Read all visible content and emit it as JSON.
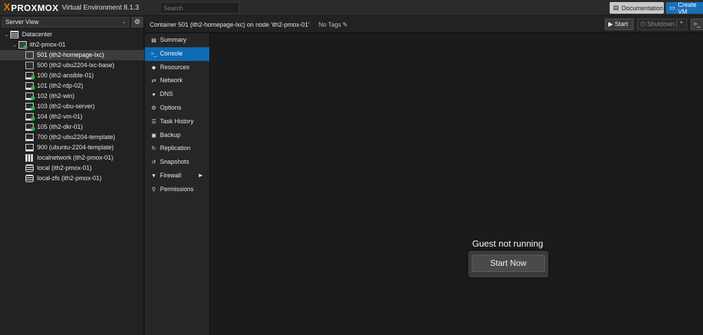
{
  "header": {
    "logo_x": "X",
    "logo_word": "PROXMOX",
    "version_label": "Virtual Environment 8.1.3",
    "search_placeholder": "Search",
    "documentation_label": "Documentation",
    "create_vm_label": "Create VM"
  },
  "sidebar": {
    "view_label": "Server View",
    "tree": [
      {
        "label": "Datacenter",
        "icon": "datacenter-icon"
      },
      {
        "label": "ith2-pmox-01",
        "icon": "node-online-icon"
      },
      {
        "label": "501 (ith2-homepage-lxc)",
        "icon": "container-stopped-icon",
        "selected": true
      },
      {
        "label": "500 (ith2-ubu2204-lxc-base)",
        "icon": "container-template-icon"
      },
      {
        "label": "100 (ith2-ansible-01)",
        "icon": "vm-running-icon"
      },
      {
        "label": "101 (ith2-rdp-02)",
        "icon": "vm-running-icon"
      },
      {
        "label": "102 (ith2-win)",
        "icon": "vm-running-icon"
      },
      {
        "label": "103 (ith2-ubu-server)",
        "icon": "vm-running-icon"
      },
      {
        "label": "104 (ith2-vm-01)",
        "icon": "vm-running-icon"
      },
      {
        "label": "105 (ith2-dkr-01)",
        "icon": "vm-running-icon"
      },
      {
        "label": "700 (ith2-ubu2204-template)",
        "icon": "vm-template-icon"
      },
      {
        "label": "900 (ubuntu-2204-template)",
        "icon": "vm-template-icon"
      },
      {
        "label": "localnetwork (ith2-pmox-01)",
        "icon": "network-icon"
      },
      {
        "label": "local (ith2-pmox-01)",
        "icon": "storage-icon"
      },
      {
        "label": "local-zfs (ith2-pmox-01)",
        "icon": "storage-icon"
      }
    ]
  },
  "content_header": {
    "title": "Container 501 (ith2-homepage-lxc) on node 'ith2-pmox-01'",
    "tags_label": "No Tags",
    "start_label": "Start",
    "shutdown_label": "Shutdown",
    "console_glyph": ">_"
  },
  "menu": {
    "items": [
      {
        "label": "Summary",
        "icon": "book-icon"
      },
      {
        "label": "Console",
        "icon": "terminal-icon",
        "selected": true
      },
      {
        "label": "Resources",
        "icon": "cube-icon"
      },
      {
        "label": "Network",
        "icon": "exchange-icon"
      },
      {
        "label": "DNS",
        "icon": "globe-icon"
      },
      {
        "label": "Options",
        "icon": "gear-icon"
      },
      {
        "label": "Task History",
        "icon": "list-icon"
      },
      {
        "label": "Backup",
        "icon": "floppy-icon"
      },
      {
        "label": "Replication",
        "icon": "retweet-icon"
      },
      {
        "label": "Snapshots",
        "icon": "history-icon"
      },
      {
        "label": "Firewall",
        "icon": "shield-icon",
        "has_submenu": true
      },
      {
        "label": "Permissions",
        "icon": "unlock-icon"
      }
    ]
  },
  "console": {
    "status_text": "Guest not running",
    "start_now_label": "Start Now"
  },
  "colors": {
    "accent": "#0d6bb4",
    "brand_orange": "#e57000",
    "running_green": "#27b24a",
    "background": "#1b1b1b"
  }
}
